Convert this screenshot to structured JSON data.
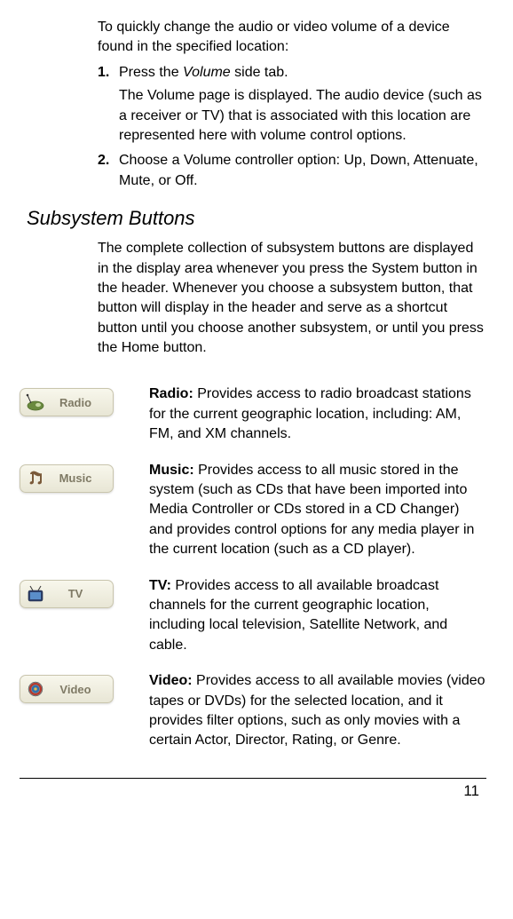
{
  "intro": "To quickly change the audio or video volume of a device found in the specified location:",
  "steps": [
    {
      "num": "1.",
      "text_prefix": "Press the ",
      "text_italic": "Volume",
      "text_suffix": " side tab.",
      "sub": "The Volume page is displayed. The audio device (such as a receiver or TV) that is associated with this location are represented here with volume control options."
    },
    {
      "num": "2.",
      "text": "Choose a Volume controller option: Up, Down, Attenuate, Mute, or Off."
    }
  ],
  "section": {
    "heading": "Subsystem Buttons",
    "desc": "The complete collection of subsystem buttons are displayed in the display area whenever you press the System button in the header. Whenever you choose a subsystem button, that button will display in the header and serve as a shortcut button until you choose another subsystem, or until you press the Home button."
  },
  "buttons": [
    {
      "label": "Radio",
      "desc_label": "Radio:",
      "desc": " Provides access to radio broadcast stations for the current geographic location, including: AM, FM, and XM channels.",
      "icon": "radio"
    },
    {
      "label": "Music",
      "desc_label": "Music:",
      "desc": " Provides access to all music stored in the system (such as CDs that have been imported into Media Controller or CDs stored in a CD Changer) and provides control options for any media player in the current location (such as a CD player).",
      "icon": "music"
    },
    {
      "label": "TV",
      "desc_label": "TV:",
      "desc": " Provides access to all available broadcast channels for the current geographic location, including local television, Satellite Network, and cable.",
      "icon": "tv"
    },
    {
      "label": "Video",
      "desc_label": "Video:",
      "desc": " Provides access to all available movies (video tapes or DVDs) for the selected location, and it provides filter options, such as only movies with a certain Actor, Director, Rating, or Genre.",
      "icon": "video"
    }
  ],
  "pageNumber": "11"
}
